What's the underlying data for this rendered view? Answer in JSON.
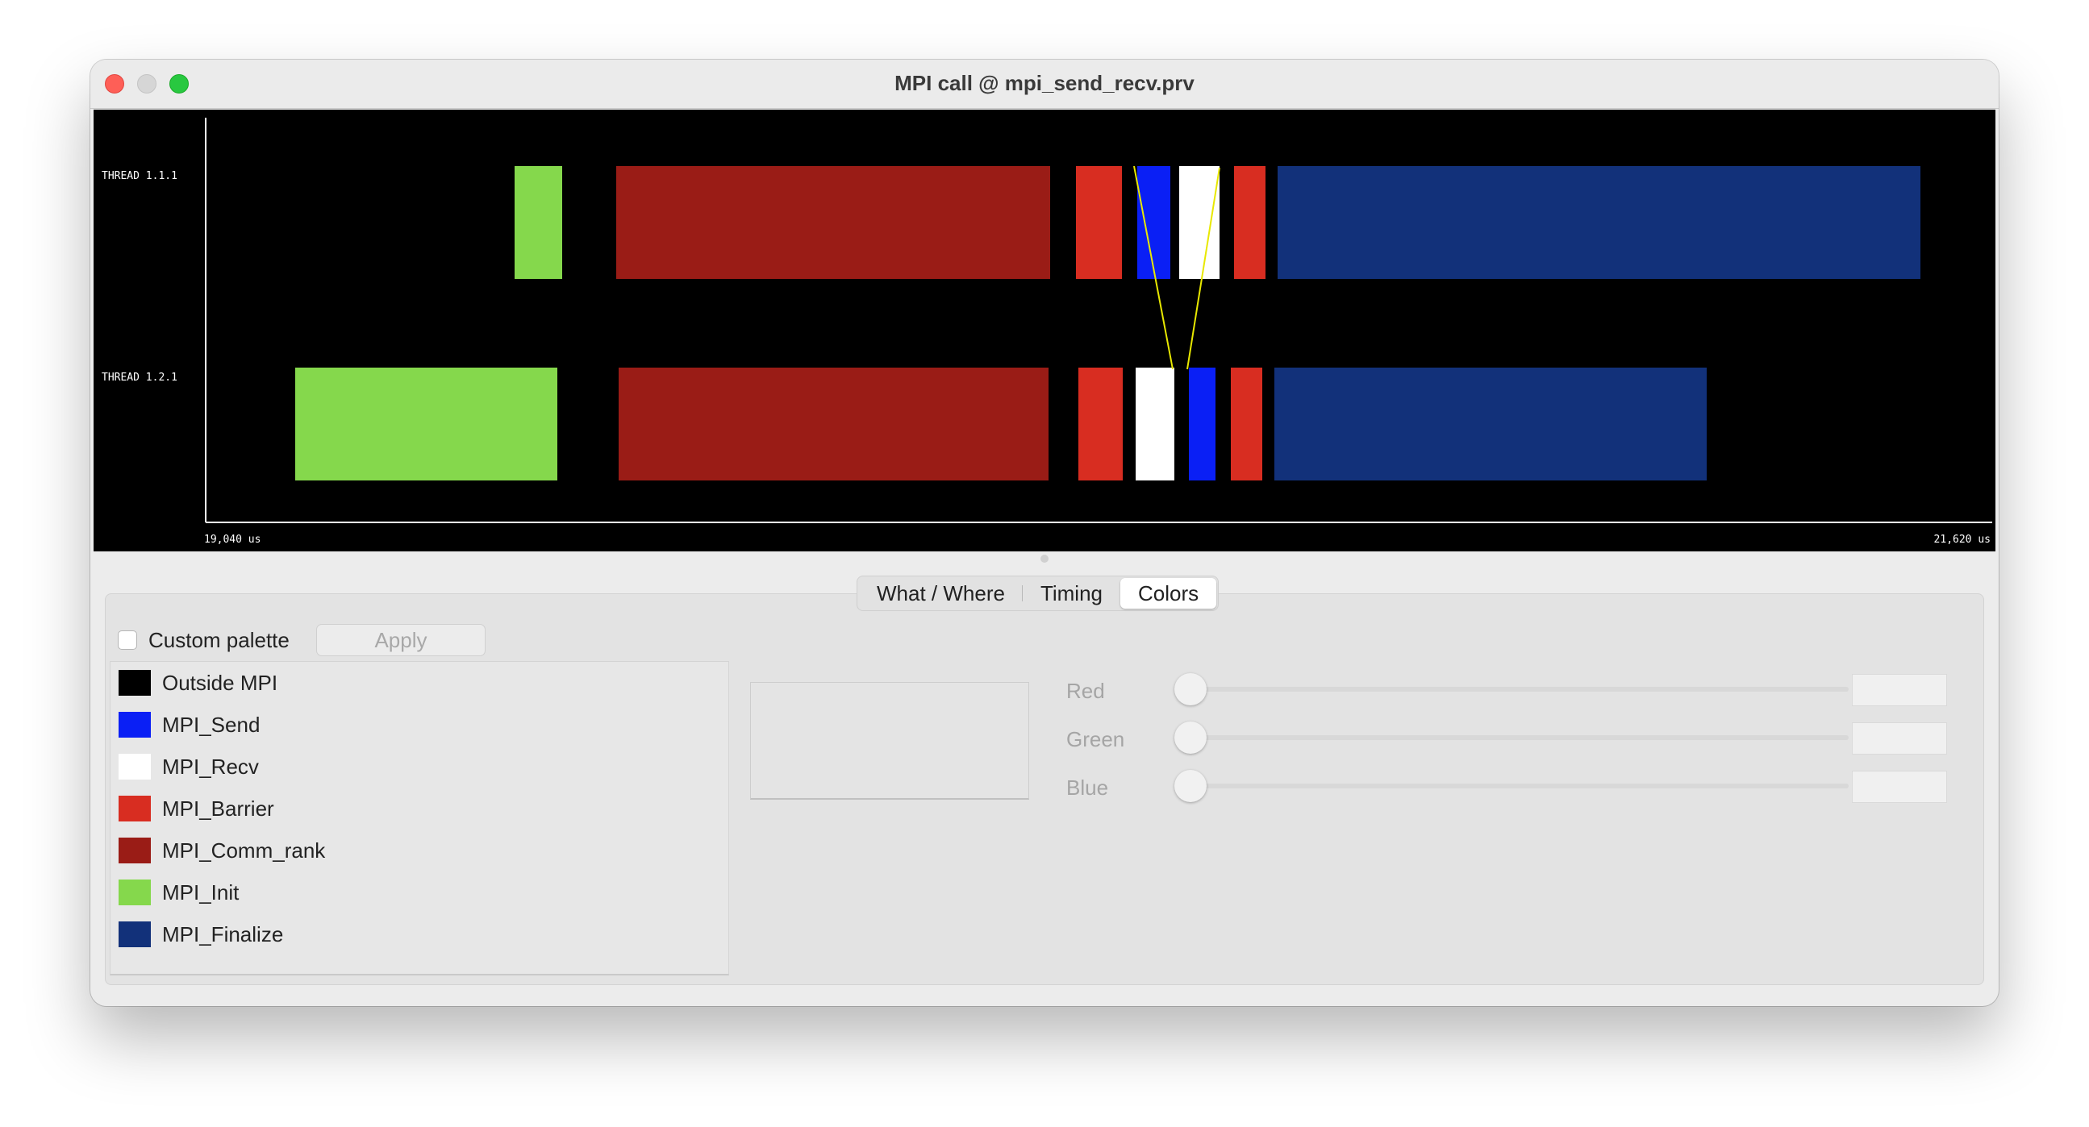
{
  "window": {
    "title": "MPI call @ mpi_send_recv.prv"
  },
  "timeline": {
    "rows": [
      "THREAD 1.1.1",
      "THREAD 1.2.1"
    ],
    "start_label": "19,040 us",
    "end_label": "21,620 us"
  },
  "tabs": [
    {
      "label": "What / Where",
      "active": false
    },
    {
      "label": "Timing",
      "active": false
    },
    {
      "label": "Colors",
      "active": true
    }
  ],
  "palette": {
    "custom_label": "Custom palette",
    "custom_checked": false,
    "apply_label": "Apply"
  },
  "legend": [
    {
      "label": "Outside MPI",
      "color": "#000000"
    },
    {
      "label": "MPI_Send",
      "color": "#0a1ff5"
    },
    {
      "label": "MPI_Recv",
      "color": "#ffffff"
    },
    {
      "label": "MPI_Barrier",
      "color": "#d82d21"
    },
    {
      "label": "MPI_Comm_rank",
      "color": "#9a1c16"
    },
    {
      "label": "MPI_Init",
      "color": "#85d84c"
    },
    {
      "label": "MPI_Finalize",
      "color": "#12317a"
    }
  ],
  "sliders": [
    {
      "label": "Red",
      "value": ""
    },
    {
      "label": "Green",
      "value": ""
    },
    {
      "label": "Blue",
      "value": ""
    }
  ]
}
